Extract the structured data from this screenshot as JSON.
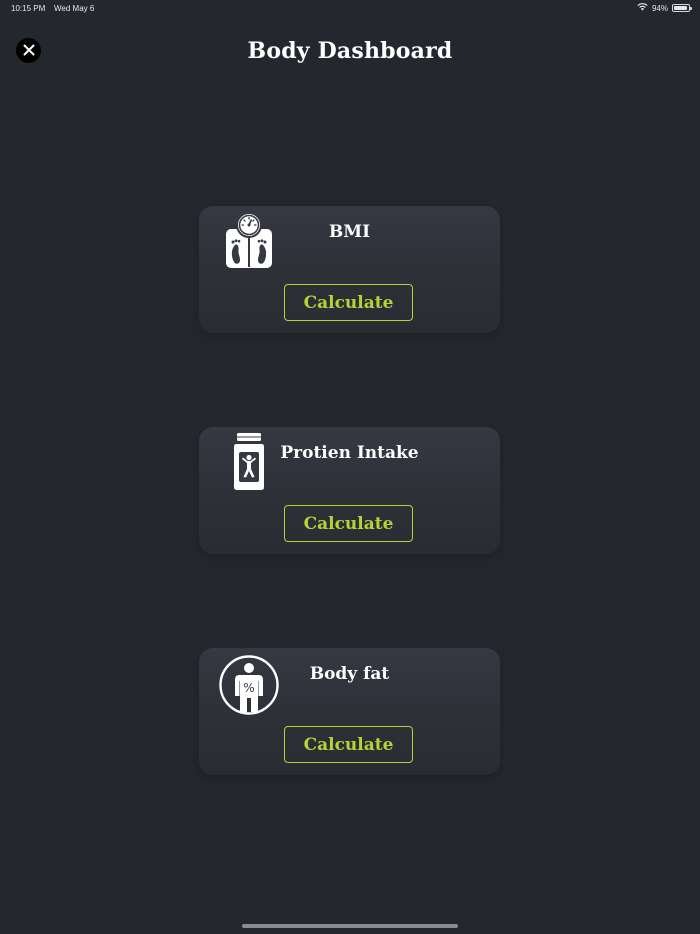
{
  "status_bar": {
    "time": "10:15 PM",
    "date": "Wed May 6",
    "battery_text": "94%",
    "battery_level": 0.94
  },
  "header": {
    "title": "Body Dashboard",
    "close_icon": "close-icon"
  },
  "cards": [
    {
      "title": "BMI",
      "icon": "scale-icon",
      "button_label": "Calculate"
    },
    {
      "title": "Protien Intake",
      "icon": "supplement-jar-icon",
      "button_label": "Calculate"
    },
    {
      "title": "Body fat",
      "icon": "body-fat-percent-icon",
      "button_label": "Calculate"
    }
  ],
  "colors": {
    "background": "#25272e",
    "card": "#32343c",
    "accent": "#b5d334",
    "text": "#ffffff"
  }
}
